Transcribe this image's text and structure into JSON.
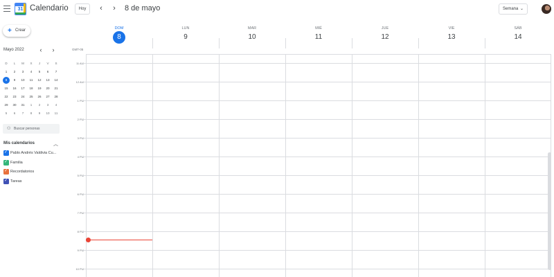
{
  "header": {
    "app_title": "Calendario",
    "logo_number": "31",
    "today_label": "Hoy",
    "prev_label": "‹",
    "next_label": "›",
    "date_title": "8 de mayo",
    "view_label": "Semana",
    "view_chevron": "⌄"
  },
  "sidebar": {
    "create_label": "Crear",
    "mini_calendar": {
      "month_label": "Mayo 2022",
      "prev": "‹",
      "next": "›",
      "weekdays": [
        "D",
        "L",
        "M",
        "X",
        "J",
        "V",
        "S"
      ],
      "weeks": [
        [
          "1",
          "2",
          "3",
          "4",
          "5",
          "6",
          "7"
        ],
        [
          "8",
          "9",
          "10",
          "11",
          "12",
          "13",
          "14"
        ],
        [
          "15",
          "16",
          "17",
          "18",
          "19",
          "20",
          "21"
        ],
        [
          "22",
          "23",
          "24",
          "25",
          "26",
          "27",
          "28"
        ],
        [
          "29",
          "30",
          "31",
          "1",
          "2",
          "3",
          "4"
        ],
        [
          "5",
          "6",
          "7",
          "8",
          "9",
          "10",
          "11"
        ]
      ],
      "selected": "8"
    },
    "search_people_placeholder": "Buscar personas",
    "my_calendars_title": "Mis calendarios",
    "calendars": [
      {
        "label": "Pablo Andrés Valdivia Cu...",
        "color": "#1a73e8"
      },
      {
        "label": "Familia",
        "color": "#33b679"
      },
      {
        "label": "Recordatorios",
        "color": "#e8713c"
      },
      {
        "label": "Tareas",
        "color": "#3f51b5"
      }
    ]
  },
  "week": {
    "timezone": "GMT-05",
    "days": [
      {
        "name": "DOM",
        "number": "8",
        "today": true
      },
      {
        "name": "LUN",
        "number": "9"
      },
      {
        "name": "MAR",
        "number": "10"
      },
      {
        "name": "MIÉ",
        "number": "11"
      },
      {
        "name": "JUE",
        "number": "12"
      },
      {
        "name": "VIE",
        "number": "13"
      },
      {
        "name": "SÁB",
        "number": "14"
      }
    ],
    "hours": [
      "11 AM",
      "12 AM",
      "1 PM",
      "2 PM",
      "3 PM",
      "4 PM",
      "5 PM",
      "6 PM",
      "7 PM",
      "8 PM",
      "9 PM",
      "10 PM"
    ]
  },
  "colors": {
    "accent": "#1a73e8",
    "now_indicator": "#ea4335",
    "grid": "#dadce0"
  }
}
